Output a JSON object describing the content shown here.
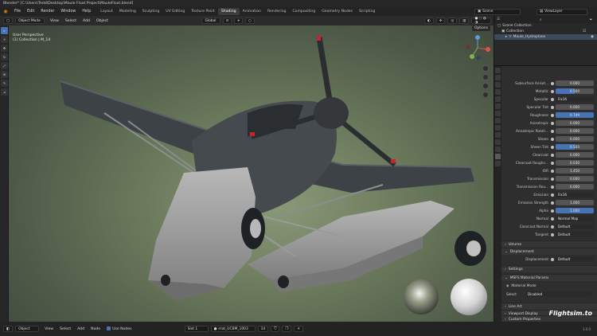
{
  "window": {
    "title": "Blender* [C:\\Users\\Tedd\\Desktop\\Maule Float Project\\MauleFloat.blend]"
  },
  "menubar": {
    "menus": [
      "File",
      "Edit",
      "Render",
      "Window",
      "Help"
    ],
    "workspaces": [
      "Layout",
      "Modeling",
      "Sculpting",
      "UV Editing",
      "Texture Paint",
      "Shading",
      "Animation",
      "Rendering",
      "Compositing",
      "Geometry Nodes",
      "Scripting"
    ],
    "active_workspace": "Shading",
    "scene_label": "Scene",
    "view_layer_label": "ViewLayer"
  },
  "toolbar": {
    "mode": "Object Mode",
    "menus": [
      "View",
      "Select",
      "Add",
      "Object"
    ],
    "transform": "Global"
  },
  "viewport": {
    "info_line1": "User Perspective",
    "info_line2": "(1) Collection | M_14",
    "options_label": "Options"
  },
  "outliner": {
    "rows": [
      {
        "label": "Scene Collection",
        "indent": 0
      },
      {
        "label": "Collection",
        "indent": 1
      },
      {
        "label": "Maule_Hydroplane",
        "indent": 2
      }
    ]
  },
  "properties": {
    "rows": [
      {
        "label": "Subsurface Anisot...",
        "value": "0.000",
        "style": ""
      },
      {
        "label": "Metallic",
        "value": "0.500",
        "style": "half"
      },
      {
        "label": "Specular",
        "value": "Fix16",
        "style": "dark"
      },
      {
        "label": "Specular Tint",
        "value": "0.000",
        "style": ""
      },
      {
        "label": "Roughness",
        "value": "0.749",
        "style": "blue"
      },
      {
        "label": "Anisotropic",
        "value": "0.000",
        "style": ""
      },
      {
        "label": "Anisotropic Rotati...",
        "value": "0.000",
        "style": ""
      },
      {
        "label": "Sheen",
        "value": "0.000",
        "style": ""
      },
      {
        "label": "Sheen Tint",
        "value": "0.500",
        "style": "half"
      },
      {
        "label": "Clearcoat",
        "value": "0.000",
        "style": ""
      },
      {
        "label": "Clearcoat Roughn...",
        "value": "0.030",
        "style": ""
      },
      {
        "label": "IOR",
        "value": "1.450",
        "style": ""
      },
      {
        "label": "Transmission",
        "value": "0.000",
        "style": ""
      },
      {
        "label": "Transmission Rou...",
        "value": "0.000",
        "style": ""
      },
      {
        "label": "Emission",
        "value": "Fix16",
        "style": "dark"
      },
      {
        "label": "Emission Strength",
        "value": "1.000",
        "style": ""
      },
      {
        "label": "Alpha",
        "value": "1.000",
        "style": "blue"
      },
      {
        "label": "Normal",
        "value": "Normal Map",
        "style": "dark"
      },
      {
        "label": "Clearcoat Normal",
        "value": "Default",
        "style": "dark"
      },
      {
        "label": "Tangent",
        "value": "Default",
        "style": "dark"
      }
    ],
    "sections": {
      "volume": "Volume",
      "displacement": "Displacement",
      "displacement_label": "Displacement",
      "displacement_value": "Default",
      "settings": "Settings",
      "msfs": "MSFS Material Params",
      "material_mode": "Material Mode",
      "select_label": "Select",
      "select_value": "Disabled",
      "line_art": "Line Art",
      "viewport_display": "Viewport Display",
      "custom_props": "Custom Properties"
    }
  },
  "statusbar": {
    "mode": "Object",
    "menus": [
      "View",
      "Select",
      "Add",
      "Node"
    ],
    "use_nodes": "Use Nodes",
    "slot": "Slot 1",
    "material": "mat_UCBM_1003",
    "users": "14",
    "version": "3.0.0"
  },
  "watermark": "Flightsim.to",
  "colors": {
    "accent": "#4772b3",
    "blender_orange": "#e87d0d"
  }
}
